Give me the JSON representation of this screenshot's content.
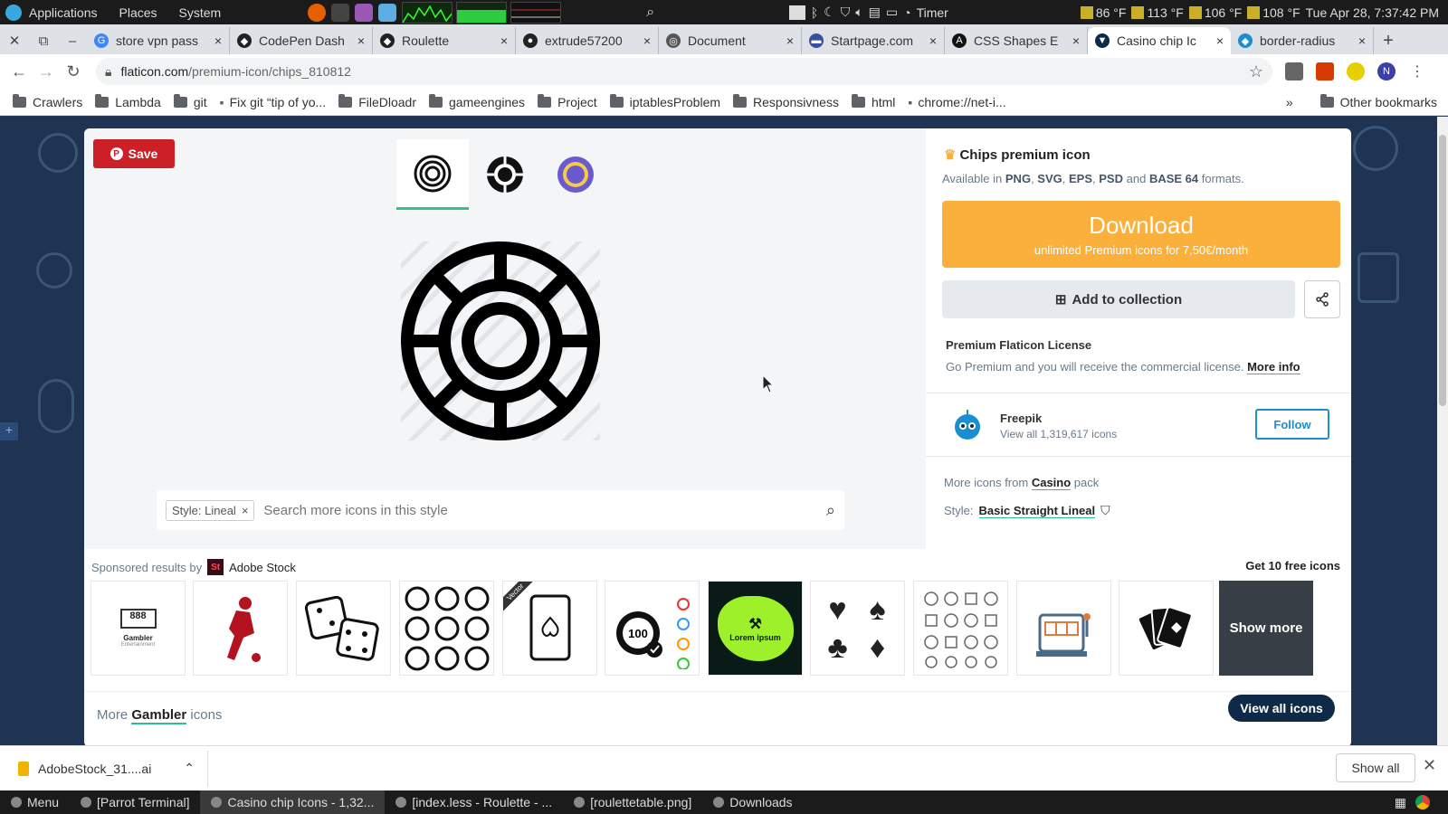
{
  "os_panel": {
    "menus": [
      "Applications",
      "Places",
      "System"
    ],
    "timer_label": "Timer",
    "temps": [
      "86 °F",
      "113 °F",
      "106 °F",
      "108 °F"
    ],
    "clock": "Tue Apr 28, 7:37:42 PM"
  },
  "tabs": [
    {
      "title": "store vpn pass",
      "color": "#4285f4",
      "glyph": "G"
    },
    {
      "title": "CodePen Dash",
      "color": "#222222",
      "glyph": "◆"
    },
    {
      "title": "Roulette",
      "color": "#222222",
      "glyph": "◆"
    },
    {
      "title": "extrude57200",
      "color": "#222222",
      "glyph": "●"
    },
    {
      "title": "Document",
      "color": "#555555",
      "glyph": "◎"
    },
    {
      "title": "Startpage.com",
      "color": "#3a4ea0",
      "glyph": "▬"
    },
    {
      "title": "CSS Shapes E",
      "color": "#111111",
      "glyph": "A"
    },
    {
      "title": "Casino chip Ic",
      "color": "#0e2a47",
      "glyph": "▼",
      "active": true
    },
    {
      "title": "border-radius",
      "color": "#1a8ed0",
      "glyph": "◆"
    }
  ],
  "address": {
    "host": "flaticon.com",
    "path": "/premium-icon/chips_810812",
    "avatar_letter": "N"
  },
  "bookmarks": [
    {
      "label": "Crawlers",
      "type": "folder"
    },
    {
      "label": "Lambda",
      "type": "folder"
    },
    {
      "label": "git",
      "type": "folder"
    },
    {
      "label": "Fix git “tip of yo...",
      "type": "page"
    },
    {
      "label": "FileDloadr",
      "type": "folder"
    },
    {
      "label": "gameengines",
      "type": "folder"
    },
    {
      "label": "Project",
      "type": "folder"
    },
    {
      "label": "iptablesProblem",
      "type": "folder"
    },
    {
      "label": "Responsivness",
      "type": "folder"
    },
    {
      "label": "html",
      "type": "folder"
    },
    {
      "label": "chrome://net-i...",
      "type": "page"
    }
  ],
  "bookmarks_more": "»",
  "other_bookmarks": "Other bookmarks",
  "modal": {
    "save_label": "Save",
    "title": "Chips premium icon",
    "formats_prefix": "Available in",
    "formats": [
      "PNG",
      "SVG",
      "EPS",
      "PSD"
    ],
    "formats_and": "and",
    "formats_last": "BASE 64",
    "formats_suffix": "formats.",
    "download_label": "Download",
    "download_sub": "unlimited Premium icons for 7,50€/month",
    "collection_label": "Add to collection",
    "license_title": "Premium Flaticon License",
    "license_desc": "Go Premium and you will receive the commercial license.",
    "license_more": "More info",
    "author_name": "Freepik",
    "author_count": "View all 1,319,617 icons",
    "follow_label": "Follow",
    "more_from": "More icons from",
    "pack_name": "Casino",
    "pack_suffix": "pack",
    "style_label": "Style:",
    "style_name": "Basic Straight Lineal",
    "search_tag": "Style: Lineal",
    "search_placeholder": "Search more icons in this style",
    "sponsored_prefix": "Sponsored results by",
    "sponsor_name": "Adobe Stock",
    "get_free": "Get 10 free icons",
    "show_more": "Show more",
    "more_prefix": "More",
    "more_keyword": "Gambler",
    "more_suffix": "icons",
    "view_all": "View all icons",
    "gambler_caption": "Gambler",
    "gambler_sub": "Entertainment",
    "vector_tag": "Vector",
    "lorem": "Lorem ipsum"
  },
  "download_shelf": {
    "file": "AdobeStock_31....ai",
    "show_all": "Show all"
  },
  "taskbar": [
    {
      "label": "Menu"
    },
    {
      "label": "[Parrot Terminal]"
    },
    {
      "label": "Casino chip Icons - 1,32...",
      "active": true
    },
    {
      "label": "[index.less - Roulette - ..."
    },
    {
      "label": "[roulettetable.png]"
    },
    {
      "label": "Downloads"
    }
  ],
  "colors": {
    "accent_download": "#fbb03b",
    "pinterest_red": "#cb2027",
    "follow_blue": "#1a8ed0",
    "green_underline": "#2ec28b",
    "modal_backdrop": "#1f3353"
  }
}
